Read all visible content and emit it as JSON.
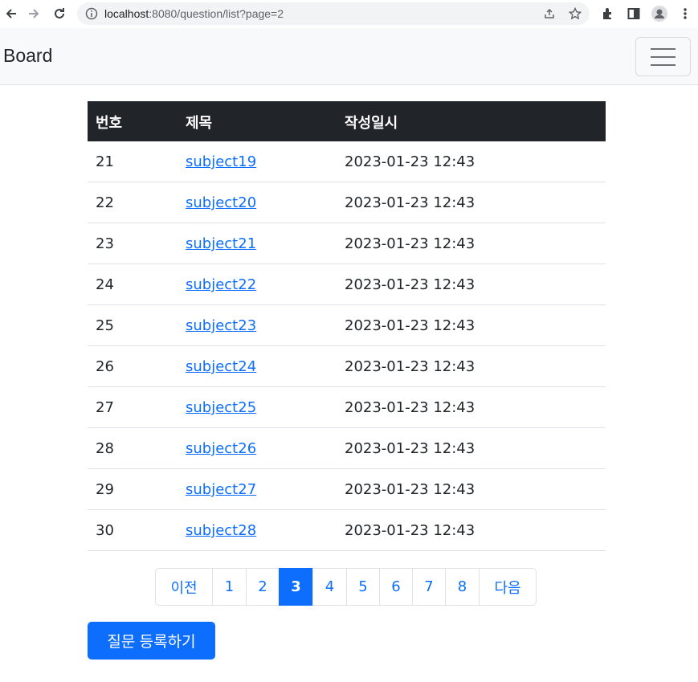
{
  "browser": {
    "url_host": "localhost",
    "url_path": ":8080/question/list?page=2",
    "icons": [
      "back-arrow-icon",
      "forward-arrow-icon",
      "reload-icon",
      "info-icon",
      "share-icon",
      "star-icon",
      "extensions-icon",
      "side-panel-icon",
      "profile-icon",
      "kebab-menu-icon"
    ]
  },
  "navbar": {
    "brand": "Board"
  },
  "table": {
    "headers": [
      "번호",
      "제목",
      "작성일시"
    ],
    "rows": [
      {
        "num": "21",
        "subject": "subject19",
        "date": "2023-01-23 12:43"
      },
      {
        "num": "22",
        "subject": "subject20",
        "date": "2023-01-23 12:43"
      },
      {
        "num": "23",
        "subject": "subject21",
        "date": "2023-01-23 12:43"
      },
      {
        "num": "24",
        "subject": "subject22",
        "date": "2023-01-23 12:43"
      },
      {
        "num": "25",
        "subject": "subject23",
        "date": "2023-01-23 12:43"
      },
      {
        "num": "26",
        "subject": "subject24",
        "date": "2023-01-23 12:43"
      },
      {
        "num": "27",
        "subject": "subject25",
        "date": "2023-01-23 12:43"
      },
      {
        "num": "28",
        "subject": "subject26",
        "date": "2023-01-23 12:43"
      },
      {
        "num": "29",
        "subject": "subject27",
        "date": "2023-01-23 12:43"
      },
      {
        "num": "30",
        "subject": "subject28",
        "date": "2023-01-23 12:43"
      }
    ]
  },
  "pagination": {
    "prev": "이전",
    "pages": [
      "1",
      "2",
      "3",
      "4",
      "5",
      "6",
      "7",
      "8"
    ],
    "active": "3",
    "next": "다음"
  },
  "actions": {
    "create_label": "질문 등록하기"
  },
  "colors": {
    "primary": "#0d6efd",
    "table_header": "#212529",
    "navbar_bg": "#f8f9fa"
  }
}
